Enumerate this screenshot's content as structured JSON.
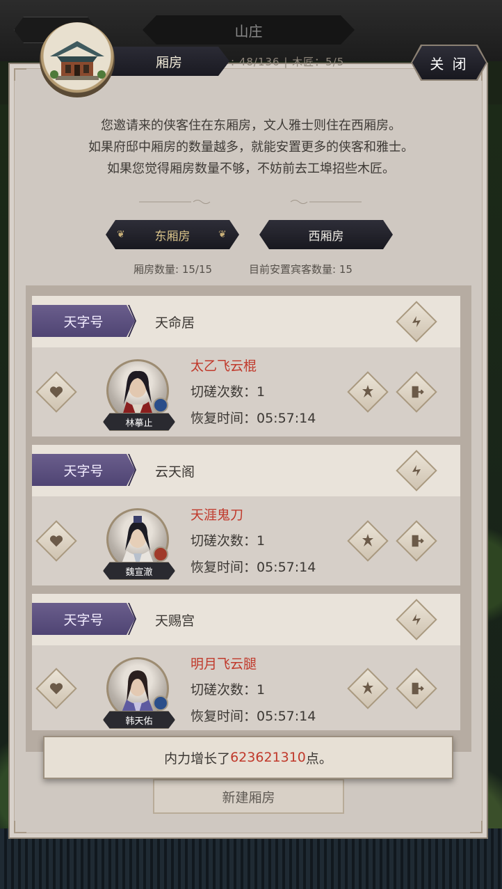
{
  "background": {
    "title": "山庄",
    "faint_stats": ": 48/136   |   木匠：5/5"
  },
  "header": {
    "tab_label": "厢房",
    "close_label": "关 闭"
  },
  "intro": {
    "lines": [
      "您邀请来的侠客住在东厢房，文人雅士则住在西厢房。",
      "如果府邸中厢房的数量越多，就能安置更多的侠客和雅士。",
      "如果您觉得厢房数量不够，不妨前去工埠招些木匠。"
    ]
  },
  "tabs": {
    "east": "东厢房",
    "west": "西厢房",
    "active": "east"
  },
  "stats": {
    "room_count": "厢房数量: 15/15",
    "guest_count": "目前安置宾客数量: 15"
  },
  "rooms": [
    {
      "rank": "天字号",
      "name": "天命居",
      "guest": "林摹止",
      "weapon": "太乙飞云棍",
      "spar": "切磋次数：1",
      "recover": "恢复时间：05:57:14"
    },
    {
      "rank": "天字号",
      "name": "云天阁",
      "guest": "魏宣澈",
      "weapon": "天涯鬼刀",
      "spar": "切磋次数：1",
      "recover": "恢复时间：05:57:14"
    },
    {
      "rank": "天字号",
      "name": "天赐宫",
      "guest": "韩天佑",
      "weapon": "明月飞云腿",
      "spar": "切磋次数：1",
      "recover": "恢复时间：05:57:14"
    }
  ],
  "toast": {
    "prefix": "内力增长了",
    "value": "623621310",
    "suffix": "点。"
  },
  "new_room_label": "新建厢房",
  "icons": {
    "favorite": "heart-icon",
    "swap": "swap-icon",
    "train": "skill-icon",
    "leave": "exit-door-icon",
    "building": "pavilion-icon"
  },
  "colors": {
    "weapon_text": "#c0392b",
    "rank_banner": "#5b4f80",
    "active_tab_text": "#d9c38a"
  }
}
